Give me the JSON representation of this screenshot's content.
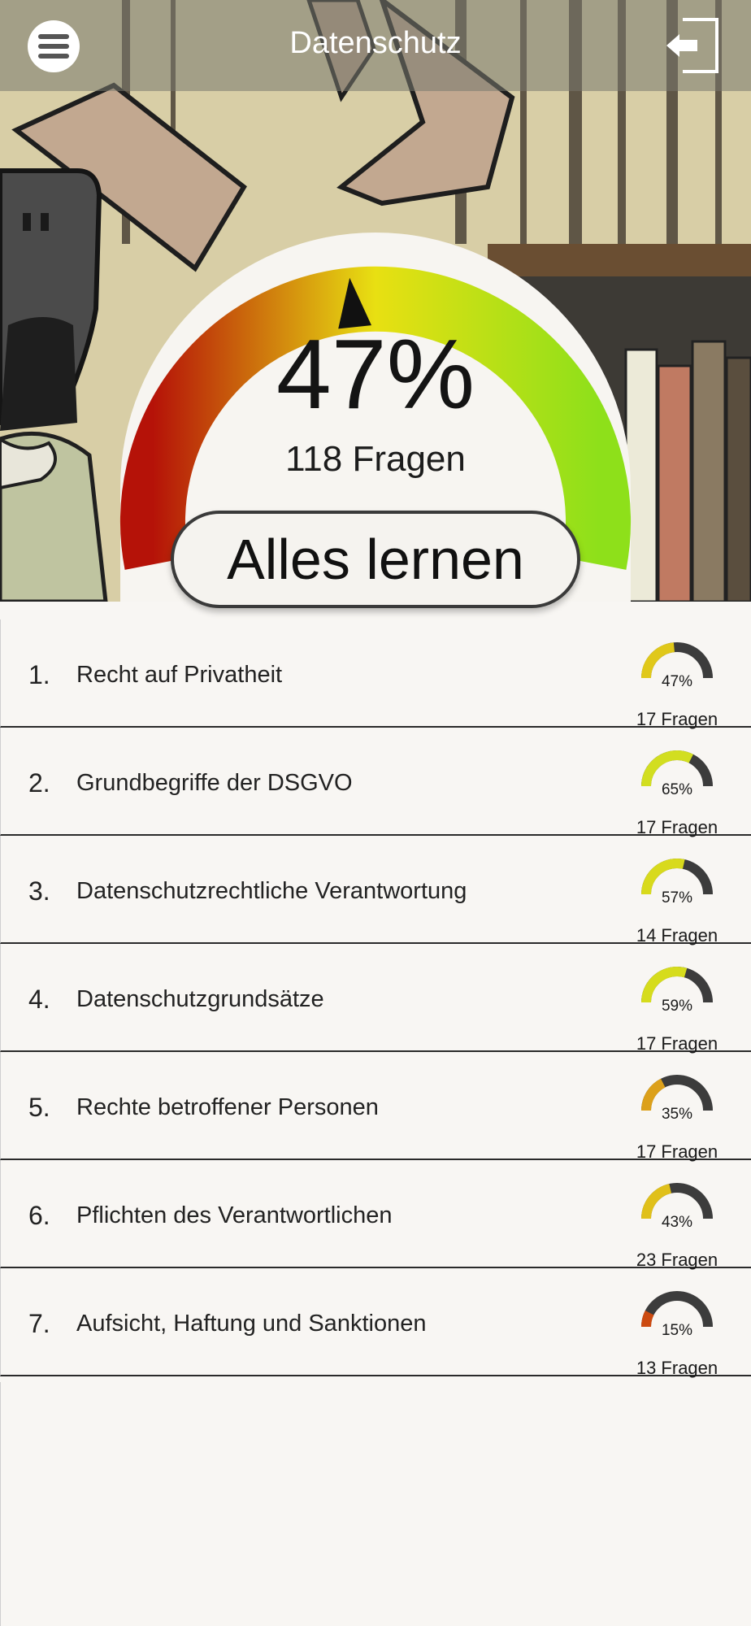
{
  "header": {
    "title": "Datenschutz",
    "menu_icon": "hamburger-menu-icon",
    "logout_icon": "logout-icon"
  },
  "summary": {
    "percent": 47,
    "percent_label": "47%",
    "count_label": "118 Fragen",
    "learn_button": "Alles lernen"
  },
  "colors": {
    "gauge_low": "#b51208",
    "gauge_mid": "#e8e012",
    "gauge_high": "#8ee01a",
    "track": "#3c3c3c"
  },
  "topics": [
    {
      "number": "1.",
      "label": "Recht auf Privatheit",
      "percent": 47,
      "percent_label": "47%",
      "count_label": "17 Fragen",
      "color": "#e0c81a"
    },
    {
      "number": "2.",
      "label": "Grundbegriffe der DSGVO",
      "percent": 65,
      "percent_label": "65%",
      "count_label": "17 Fragen",
      "color": "#d2de20"
    },
    {
      "number": "3.",
      "label": "Datenschutzrechtliche Verantwortung",
      "percent": 57,
      "percent_label": "57%",
      "count_label": "14 Fragen",
      "color": "#d8da1c"
    },
    {
      "number": "4.",
      "label": "Datenschutzgrundsätze",
      "percent": 59,
      "percent_label": "59%",
      "count_label": "17 Fragen",
      "color": "#d6dc1c"
    },
    {
      "number": "5.",
      "label": "Rechte betroffener Personen",
      "percent": 35,
      "percent_label": "35%",
      "count_label": "17 Fragen",
      "color": "#dca01a"
    },
    {
      "number": "6.",
      "label": "Pflichten des Verantwortlichen",
      "percent": 43,
      "percent_label": "43%",
      "count_label": "23 Fragen",
      "color": "#e0c01a"
    },
    {
      "number": "7.",
      "label": "Aufsicht, Haftung und Sanktionen",
      "percent": 15,
      "percent_label": "15%",
      "count_label": "13 Fragen",
      "color": "#cc4a10"
    }
  ]
}
